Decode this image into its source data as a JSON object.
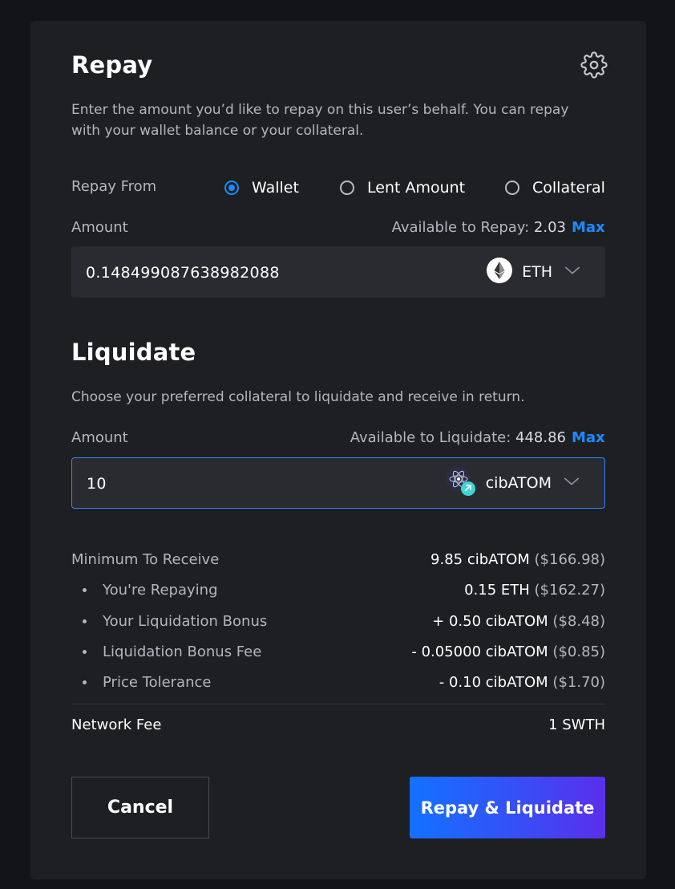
{
  "repay": {
    "title": "Repay",
    "description": "Enter the amount you’d like to repay on this user’s behalf. You can repay with your wallet balance or your collateral.",
    "repay_from_label": "Repay From",
    "options": [
      {
        "label": "Wallet",
        "selected": true
      },
      {
        "label": "Lent Amount",
        "selected": false
      },
      {
        "label": "Collateral",
        "selected": false
      }
    ],
    "amount_label": "Amount",
    "available_label": "Available to Repay:",
    "available_value": "2.03",
    "max_label": "Max",
    "amount_value": "0.148499087638982088",
    "token": "ETH"
  },
  "liquidate": {
    "title": "Liquidate",
    "description": "Choose your preferred collateral to liquidate and receive in return.",
    "amount_label": "Amount",
    "available_label": "Available to Liquidate:",
    "available_value": "448.86",
    "max_label": "Max",
    "amount_value": "10",
    "token": "cibATOM"
  },
  "summary": {
    "minimum": {
      "label": "Minimum To Receive",
      "amount": "9.85 cibATOM",
      "usd": "($166.98)"
    },
    "items": [
      {
        "label": "You're Repaying",
        "amount": "0.15 ETH",
        "usd": "($162.27)"
      },
      {
        "label": "Your Liquidation Bonus",
        "amount": "+ 0.50 cibATOM",
        "usd": "($8.48)"
      },
      {
        "label": "Liquidation Bonus Fee",
        "amount": "- 0.05000 cibATOM",
        "usd": "($0.85)"
      },
      {
        "label": "Price Tolerance",
        "amount": "- 0.10 cibATOM",
        "usd": "($1.70)"
      }
    ],
    "network_fee": {
      "label": "Network Fee",
      "value": "1 SWTH"
    }
  },
  "buttons": {
    "cancel": "Cancel",
    "submit": "Repay & Liquidate"
  },
  "colors": {
    "accent": "#1A8CFF",
    "panel": "#1E1F22",
    "background": "#131417",
    "field": "#2A2B30"
  },
  "icons": {
    "settings": "gear-icon",
    "eth": "ethereum-icon",
    "atom": "cibatom-icon",
    "dropdown": "chevron-down-icon"
  }
}
